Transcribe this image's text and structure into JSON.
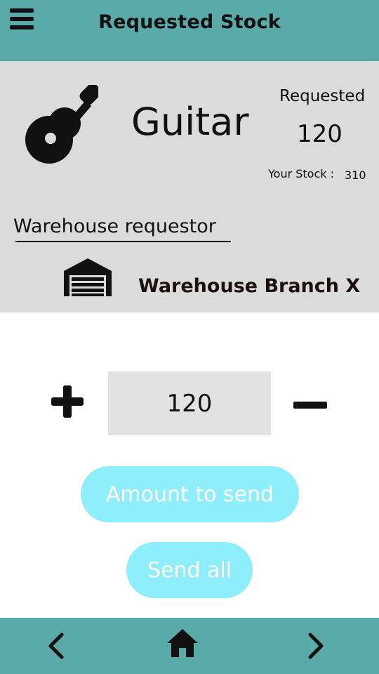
{
  "header": {
    "title": "Requested Stock",
    "menu_icon": "hamburger-menu-icon"
  },
  "product": {
    "icon": "guitar-icon",
    "name": "Guitar",
    "requested_label": "Requested",
    "requested_value": "120",
    "stock_label": "Your Stock :",
    "stock_value": "310"
  },
  "requestor": {
    "label": "Warehouse requestor",
    "icon": "warehouse-icon",
    "name": "Warehouse Branch X"
  },
  "quantity": {
    "value": "120",
    "plus_icon": "plus-icon",
    "minus_icon": "minus-icon"
  },
  "actions": {
    "amount_label": "Amount to send",
    "send_all_label": "Send all"
  },
  "footer": {
    "back_icon": "chevron-left-icon",
    "home_icon": "home-icon",
    "forward_icon": "chevron-right-icon"
  },
  "colors": {
    "bar": "#5aaaa9",
    "card": "#dcdbdb",
    "quantity_box": "#e2e2e2",
    "button": "#8eeefc",
    "button_text": "#ffffff"
  }
}
